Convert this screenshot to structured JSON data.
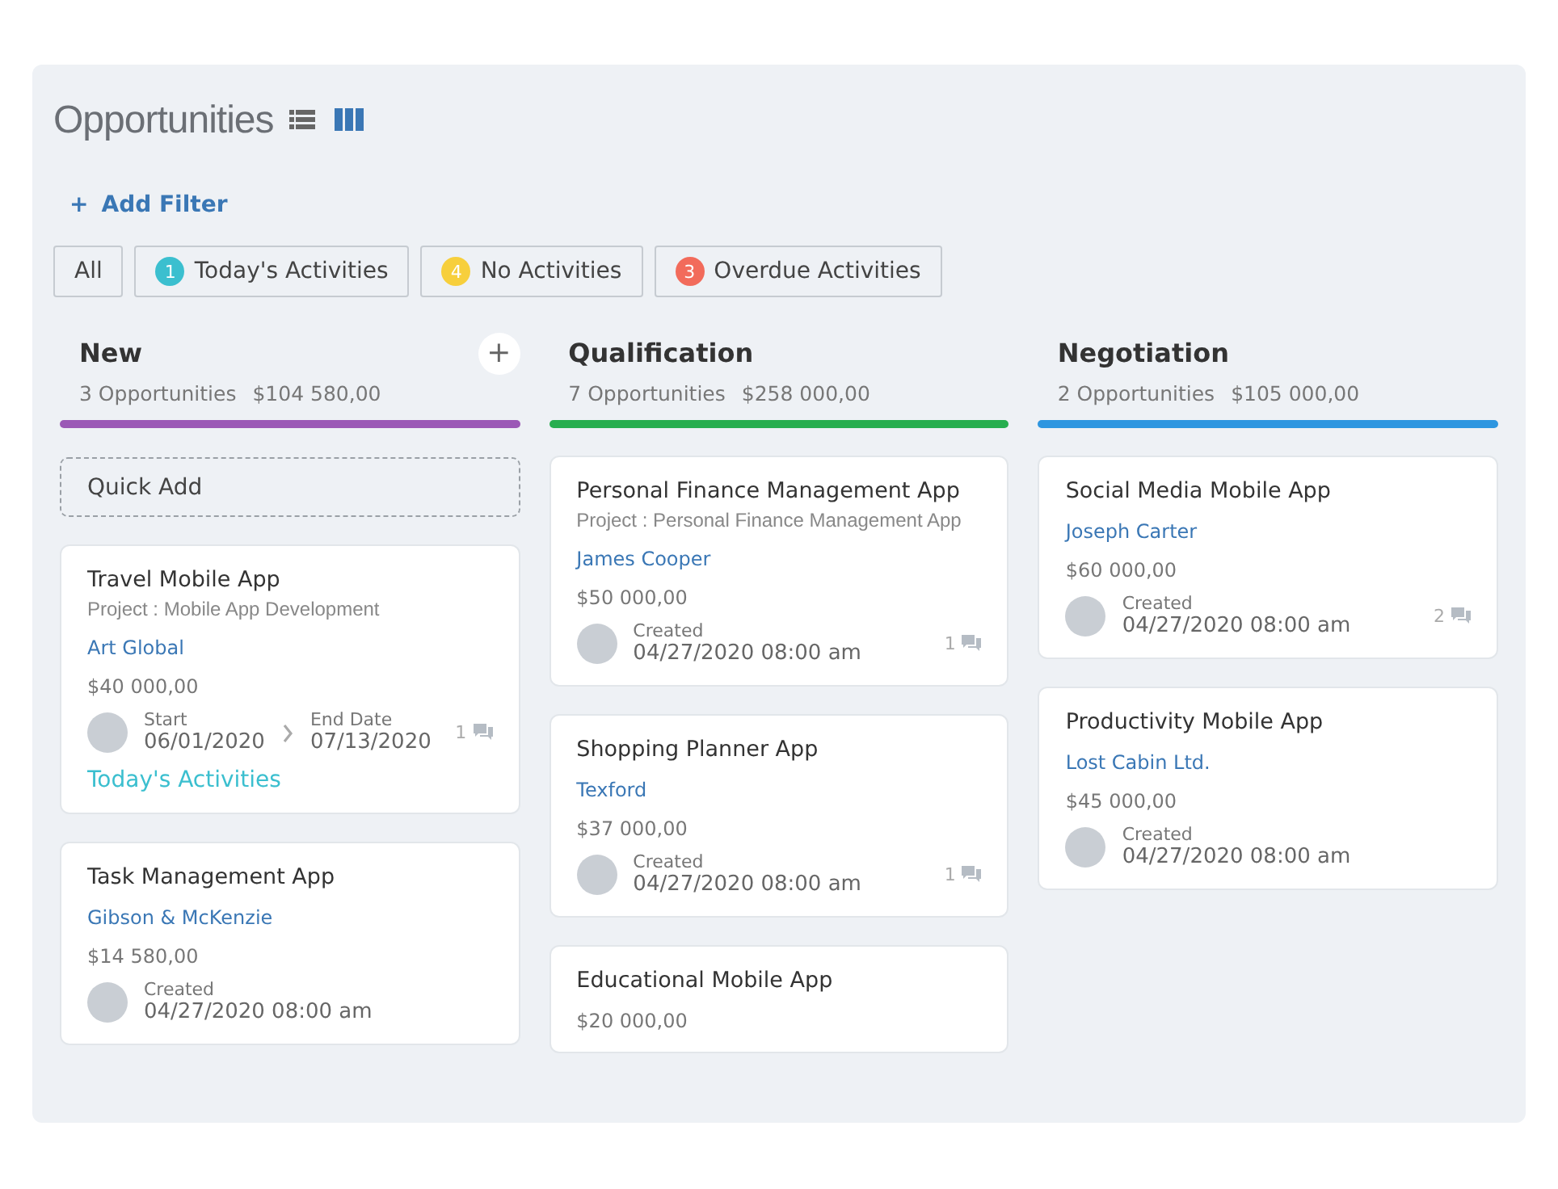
{
  "header": {
    "title": "Opportunities",
    "views": [
      {
        "kind": "list",
        "selected": false
      },
      {
        "kind": "board",
        "selected": true
      }
    ]
  },
  "add_filter": {
    "icon": "+",
    "label": "Add Filter"
  },
  "filters": [
    {
      "label": "All",
      "selected": false
    },
    {
      "label": "Today's Activities",
      "count": "1",
      "color": "#3bbfcf",
      "selected": false
    },
    {
      "label": "No Activities",
      "count": "4",
      "color": "#f7cf3c",
      "selected": false
    },
    {
      "label": "Overdue Activities",
      "count": "3",
      "color": "#f26b5b",
      "selected": false
    }
  ],
  "columns": [
    {
      "name": "New",
      "count": "3 Opportunities",
      "total": "$104 580,00",
      "color": "#9b59b6",
      "add_icon": "+",
      "quick_add": "Quick Add",
      "cards": [
        {
          "title": "Travel Mobile App",
          "project": "Project : Mobile App Development",
          "contact": "Art Global",
          "amount": "$40 000,00",
          "footer": {
            "kind": "dates",
            "start_label": "Start",
            "start": "06/01/2020",
            "end_label": "End Date",
            "end": "07/13/2020"
          },
          "comments": "1",
          "activity": "Today's Activities"
        },
        {
          "title": "Task Management App",
          "contact": "Gibson & McKenzie",
          "amount": "$14 580,00",
          "footer": {
            "kind": "created",
            "label": "Created",
            "date": "04/27/2020 08:00 am"
          }
        }
      ]
    },
    {
      "name": "Qualification",
      "count": "7 Opportunities",
      "total": "$258 000,00",
      "color": "#27ae4f",
      "cards": [
        {
          "title": "Personal Finance Management App",
          "project": "Project : Personal Finance Management App",
          "contact": "James Cooper",
          "amount": "$50 000,00",
          "footer": {
            "kind": "created",
            "label": "Created",
            "date": "04/27/2020 08:00 am"
          },
          "comments": "1"
        },
        {
          "title": "Shopping Planner App",
          "contact": "Texford",
          "amount": "$37 000,00",
          "footer": {
            "kind": "created",
            "label": "Created",
            "date": "04/27/2020 08:00 am"
          },
          "comments": "1"
        },
        {
          "title": "Educational Mobile App",
          "amount": "$20 000,00"
        }
      ]
    },
    {
      "name": "Negotiation",
      "count": "2 Opportunities",
      "total": "$105 000,00",
      "color": "#2e96e0",
      "cards": [
        {
          "title": "Social Media Mobile App",
          "contact": "Joseph Carter",
          "amount": "$60 000,00",
          "footer": {
            "kind": "created",
            "label": "Created",
            "date": "04/27/2020 08:00 am"
          },
          "comments": "2"
        },
        {
          "title": "Productivity Mobile App",
          "contact": "Lost Cabin Ltd.",
          "amount": "$45 000,00",
          "footer": {
            "kind": "created",
            "label": "Created",
            "date": "04/27/2020 08:00 am"
          }
        }
      ]
    }
  ]
}
